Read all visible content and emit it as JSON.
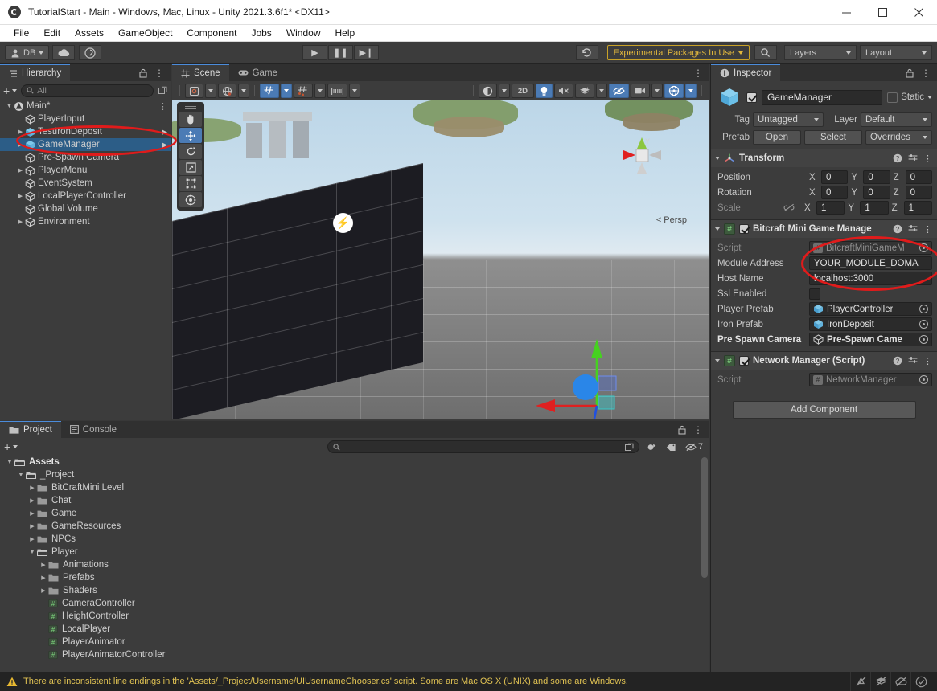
{
  "window": {
    "title": "TutorialStart - Main - Windows, Mac, Linux - Unity 2021.3.6f1* <DX11>",
    "minimize": "—",
    "maximize": "□",
    "close": "✕"
  },
  "menubar": {
    "items": [
      "File",
      "Edit",
      "Assets",
      "GameObject",
      "Component",
      "Jobs",
      "Window",
      "Help"
    ]
  },
  "toolbar": {
    "account_label": "DB",
    "play": "▶",
    "pause": "❚❚",
    "step": "▶❙",
    "history_icon": "undo-history-icon",
    "experimental_packages": "Experimental Packages In Use",
    "search_icon": "search-icon",
    "layers": "Layers",
    "layout": "Layout"
  },
  "hierarchy": {
    "tab": "Hierarchy",
    "search_placeholder": "All",
    "add_label": "+",
    "items": [
      {
        "label": "Main*",
        "depth": 0,
        "expanded": true,
        "scene": true,
        "more": "⋮"
      },
      {
        "label": "PlayerInput",
        "depth": 1,
        "expanded": false,
        "arrow": false
      },
      {
        "label": "TestIronDeposit",
        "depth": 1,
        "expanded": false,
        "arrow": true,
        "prefab": true
      },
      {
        "label": "GameManager",
        "depth": 1,
        "expanded": false,
        "arrow": true,
        "selected": true,
        "prefab": true
      },
      {
        "label": "Pre-Spawn Camera",
        "depth": 1,
        "expanded": false,
        "arrow": false
      },
      {
        "label": "PlayerMenu",
        "depth": 1,
        "expanded": false,
        "arrow": false,
        "collapsible": true
      },
      {
        "label": "EventSystem",
        "depth": 1,
        "expanded": false,
        "arrow": false
      },
      {
        "label": "LocalPlayerController",
        "depth": 1,
        "expanded": false,
        "collapsible": true
      },
      {
        "label": "Global Volume",
        "depth": 1,
        "expanded": false
      },
      {
        "label": "Environment",
        "depth": 1,
        "expanded": false,
        "collapsible": true
      }
    ]
  },
  "scene": {
    "tabs": [
      {
        "label": "Scene",
        "active": true,
        "icon": "grid-icon"
      },
      {
        "label": "Game",
        "active": false,
        "icon": "gamepad-icon"
      }
    ],
    "toolbar": {
      "pivot_mode": "center-pivot-icon",
      "handle_space": "global-handle-icon",
      "grid_axis": "grid-y-icon",
      "snap_increment": "snap-increment-icon",
      "grid_scale": "grid-ruler-icon",
      "shading_mode": "shaded-icon",
      "twod_label": "2D",
      "lighting": "light-bulb-icon",
      "audio": "audio-mute-icon",
      "fx": "effects-icon",
      "hidden_objects": "eye-off-icon",
      "camera": "scene-camera-icon",
      "gizmos": "gizmos-icon"
    },
    "view_label": "Persp",
    "axis_y_label": "Y",
    "tools": [
      "hand-tool",
      "move-tool",
      "rotate-tool",
      "scale-tool",
      "rect-tool",
      "transform-tool"
    ],
    "active_tool": "move-tool"
  },
  "inspector": {
    "tab": "Inspector",
    "object_name": "GameManager",
    "enabled": true,
    "static_label": "Static",
    "tag_label": "Tag",
    "tag_value": "Untagged",
    "layer_label": "Layer",
    "layer_value": "Default",
    "prefab_label": "Prefab",
    "prefab_open": "Open",
    "prefab_select": "Select",
    "prefab_overrides": "Overrides",
    "components": [
      {
        "name": "Transform",
        "icon": "transform-icon",
        "has_checkbox": false,
        "rows": [
          {
            "label": "Position",
            "axes": [
              {
                "axis": "X",
                "value": "0"
              },
              {
                "axis": "Y",
                "value": "0"
              },
              {
                "axis": "Z",
                "value": "0"
              }
            ]
          },
          {
            "label": "Rotation",
            "axes": [
              {
                "axis": "X",
                "value": "0"
              },
              {
                "axis": "Y",
                "value": "0"
              },
              {
                "axis": "Z",
                "value": "0"
              }
            ]
          },
          {
            "label": "Scale",
            "link_icon": "link-off-icon",
            "axes": [
              {
                "axis": "X",
                "value": "1"
              },
              {
                "axis": "Y",
                "value": "1"
              },
              {
                "axis": "Z",
                "value": "1"
              }
            ]
          }
        ]
      },
      {
        "name": "Bitcraft Mini Game Manage",
        "icon": "script-icon",
        "has_checkbox": true,
        "checked": true,
        "fields": [
          {
            "label": "Script",
            "type": "object",
            "value": "BitcraftMiniGameM",
            "dim": true,
            "icon": "script-file-icon"
          },
          {
            "label": "Module Address",
            "type": "text",
            "value": "YOUR_MODULE_DOMA"
          },
          {
            "label": "Host Name",
            "type": "text",
            "value": "localhost:3000"
          },
          {
            "label": "Ssl Enabled",
            "type": "checkbox",
            "checked": false
          },
          {
            "label": "Player Prefab",
            "type": "object",
            "value": "PlayerController",
            "icon": "prefab-icon"
          },
          {
            "label": "Iron Prefab",
            "type": "object",
            "value": "IronDeposit",
            "icon": "prefab-icon"
          },
          {
            "label": "Pre Spawn Camera",
            "type": "object",
            "value": "Pre-Spawn Came",
            "icon": "gameobject-icon",
            "bold": true
          }
        ]
      },
      {
        "name": "Network Manager (Script)",
        "icon": "script-icon",
        "has_checkbox": true,
        "checked": true,
        "fields": [
          {
            "label": "Script",
            "type": "object",
            "value": "NetworkManager",
            "dim": true,
            "icon": "script-file-icon"
          }
        ]
      }
    ],
    "add_component": "Add Component"
  },
  "project": {
    "tabs": [
      {
        "label": "Project",
        "active": true,
        "icon": "folder-icon"
      },
      {
        "label": "Console",
        "active": false,
        "icon": "console-icon"
      }
    ],
    "add_label": "+",
    "search_placeholder": "",
    "filter_count": "7",
    "tree": [
      {
        "label": "Assets",
        "depth": 0,
        "expanded": true,
        "type": "folder-open",
        "bold": true
      },
      {
        "label": "_Project",
        "depth": 1,
        "expanded": true,
        "type": "folder-open"
      },
      {
        "label": "BitCraftMini Level",
        "depth": 2,
        "expanded": false,
        "type": "folder"
      },
      {
        "label": "Chat",
        "depth": 2,
        "expanded": false,
        "type": "folder"
      },
      {
        "label": "Game",
        "depth": 2,
        "expanded": false,
        "type": "folder"
      },
      {
        "label": "GameResources",
        "depth": 2,
        "expanded": false,
        "type": "folder"
      },
      {
        "label": "NPCs",
        "depth": 2,
        "expanded": false,
        "type": "folder"
      },
      {
        "label": "Player",
        "depth": 2,
        "expanded": true,
        "type": "folder-open"
      },
      {
        "label": "Animations",
        "depth": 3,
        "expanded": false,
        "type": "folder"
      },
      {
        "label": "Prefabs",
        "depth": 3,
        "expanded": false,
        "type": "folder"
      },
      {
        "label": "Shaders",
        "depth": 3,
        "expanded": false,
        "type": "folder"
      },
      {
        "label": "CameraController",
        "depth": 3,
        "type": "script"
      },
      {
        "label": "HeightController",
        "depth": 3,
        "type": "script"
      },
      {
        "label": "LocalPlayer",
        "depth": 3,
        "type": "script"
      },
      {
        "label": "PlayerAnimator",
        "depth": 3,
        "type": "script"
      },
      {
        "label": "PlayerAnimatorController",
        "depth": 3,
        "type": "script"
      }
    ]
  },
  "statusbar": {
    "warning_icon": "warning-triangle-icon",
    "message": "There are inconsistent line endings in the 'Assets/_Project/Username/UIUsernameChooser.cs' script. Some are Mac OS X (UNIX) and some are Windows.",
    "icons": [
      "collab-off-icon",
      "layers-off-icon",
      "cloud-off-icon",
      "check-circle-icon"
    ]
  },
  "colors": {
    "accent_blue": "#4b7bb5",
    "selection": "#2c5d87",
    "warning": "#e0c253",
    "annotation_red": "#e01b1b",
    "experimental_gold": "#e0b63c"
  }
}
